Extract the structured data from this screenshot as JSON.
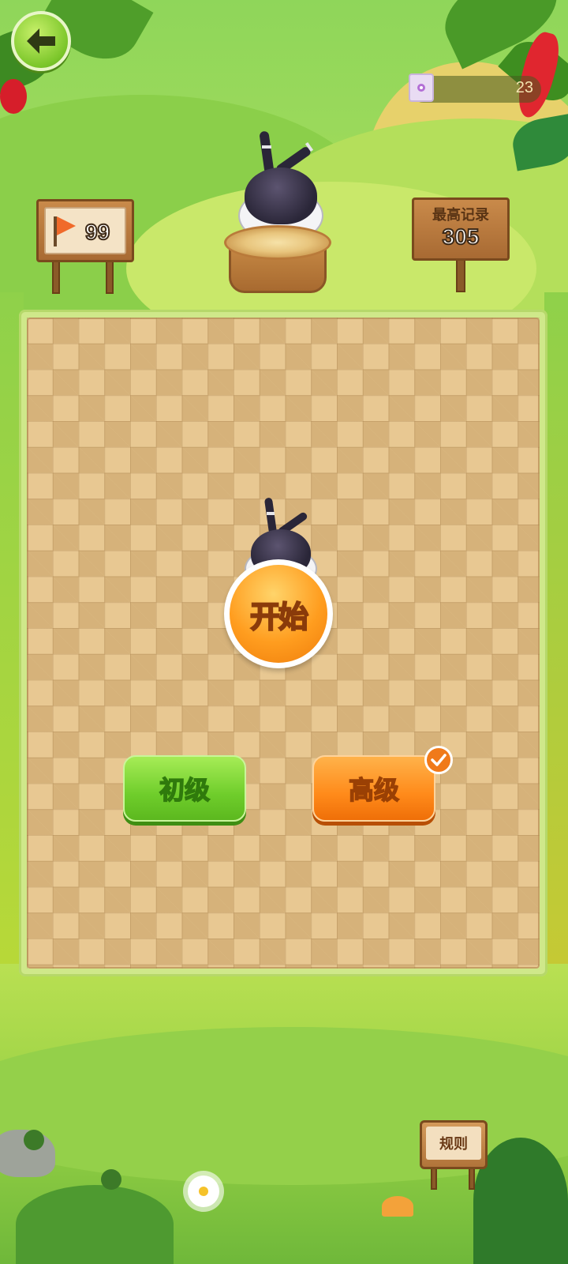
{
  "hud": {
    "card_count": "23",
    "level_flag_number": "99",
    "best_record_title": "最高记录",
    "best_record_value": "305"
  },
  "controls": {
    "start_label": "开始",
    "easy_label": "初级",
    "hard_label": "高级",
    "selected_level": "高级",
    "rules_label": "规则"
  },
  "icons": {
    "back": "back-arrow-icon",
    "card": "card-icon",
    "flag": "flag-icon",
    "check": "check-icon"
  },
  "colors": {
    "accent_orange": "#ff8a1a",
    "accent_green": "#6fcd2b",
    "board_light": "#e8c892",
    "board_dark": "#d6b27a"
  }
}
